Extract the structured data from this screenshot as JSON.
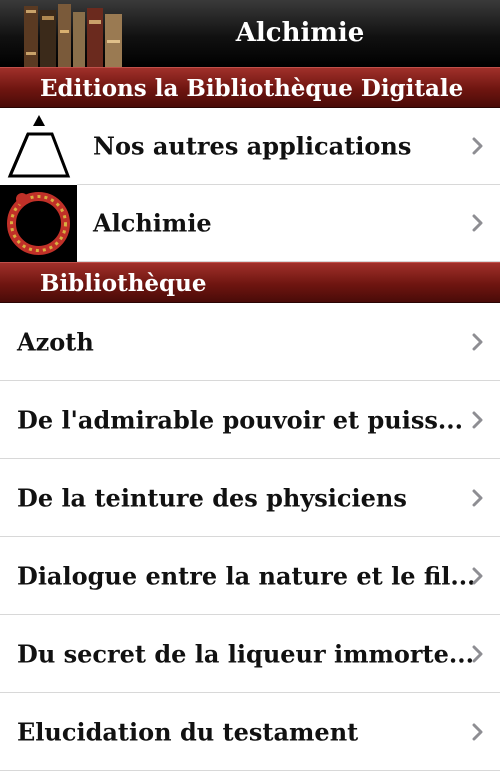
{
  "navbar": {
    "title": "Alchimie"
  },
  "sections": [
    {
      "header": "Editions la Bibliothèque Digitale",
      "items": [
        {
          "label": "Nos autres applications",
          "icon": "triangle-prism-icon"
        },
        {
          "label": "Alchimie",
          "icon": "ouroboros-icon"
        }
      ]
    },
    {
      "header": "Bibliothèque",
      "items": [
        {
          "label": "Azoth"
        },
        {
          "label": "De l'admirable pouvoir et puiss..."
        },
        {
          "label": "De la teinture des physiciens"
        },
        {
          "label": "Dialogue entre la nature et le fil..."
        },
        {
          "label": "Du secret de la liqueur immorte..."
        },
        {
          "label": "Elucidation du testament"
        }
      ]
    }
  ],
  "colors": {
    "accent": "#6e1510",
    "navbar": "#111111",
    "chevron": "#8e8e93"
  }
}
